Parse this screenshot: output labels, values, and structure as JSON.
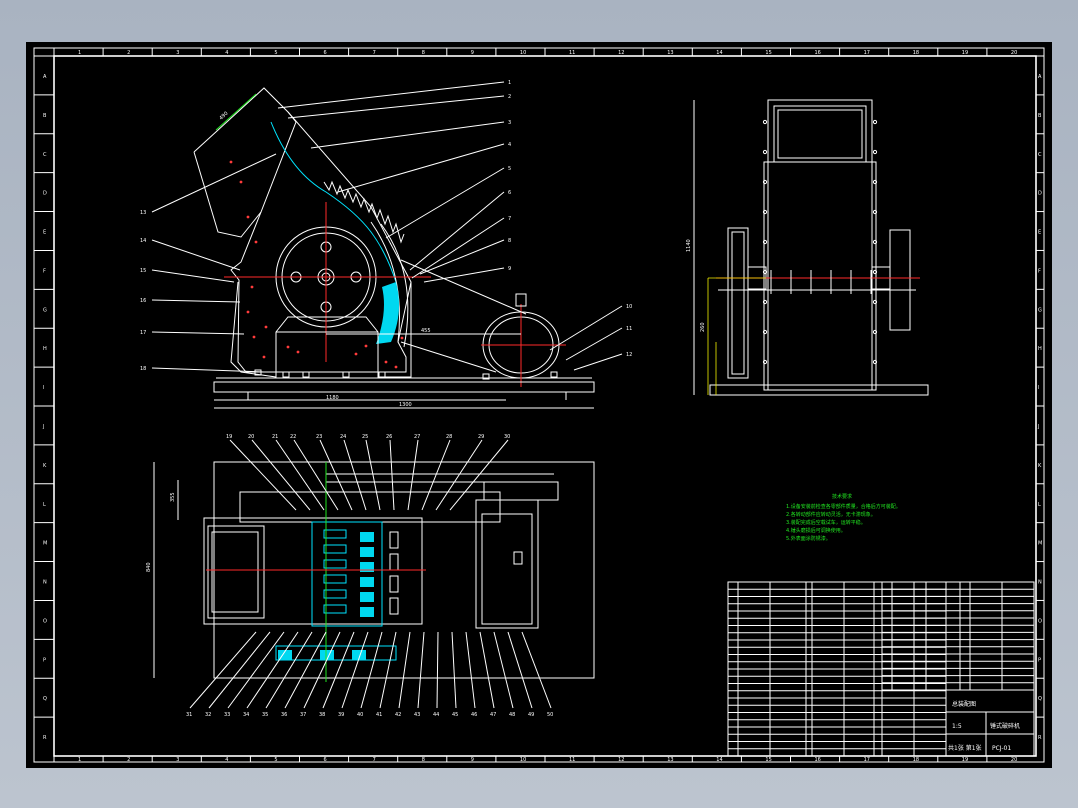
{
  "drawing": {
    "tech_notes_title": "技术要求",
    "tech_notes": [
      "1.设备安装前检查各零部件质量，合格后方可装配。",
      "2.各转动部件应转动灵活，无卡滞现象。",
      "3.装配完成后空载试车，运转平稳。",
      "4.锤头磨损后可调换使用。",
      "5.外表面涂防锈漆。"
    ],
    "part_balloons": [
      "1",
      "2",
      "3",
      "4",
      "5",
      "6",
      "7",
      "8",
      "9",
      "10",
      "11",
      "12",
      "13",
      "14",
      "15",
      "16",
      "17",
      "18",
      "19",
      "20",
      "21",
      "22",
      "23",
      "24",
      "25",
      "26",
      "27",
      "28",
      "29",
      "30",
      "31",
      "32",
      "33",
      "34",
      "35",
      "36",
      "37",
      "38",
      "39",
      "40",
      "41",
      "42",
      "43",
      "44",
      "45",
      "46",
      "47",
      "48",
      "49",
      "50"
    ],
    "dimensions": [
      "490",
      "355",
      "1300",
      "1180",
      "840",
      "1140",
      "260",
      "455"
    ],
    "border_columns": [
      "1",
      "2",
      "3",
      "4",
      "5",
      "6",
      "7",
      "8",
      "9",
      "10",
      "11",
      "12",
      "13",
      "14",
      "15",
      "16",
      "17",
      "18",
      "19",
      "20"
    ],
    "border_rows": [
      "A",
      "B",
      "C",
      "D",
      "E",
      "F",
      "G",
      "H",
      "I",
      "J",
      "K",
      "L",
      "M",
      "N",
      "O",
      "P",
      "Q",
      "R"
    ],
    "title_block": {
      "name": "锤式破碎机",
      "label": "总装配图",
      "code": "PCJ-01",
      "scale": "1:5",
      "sheet": "共1张 第1张"
    }
  }
}
